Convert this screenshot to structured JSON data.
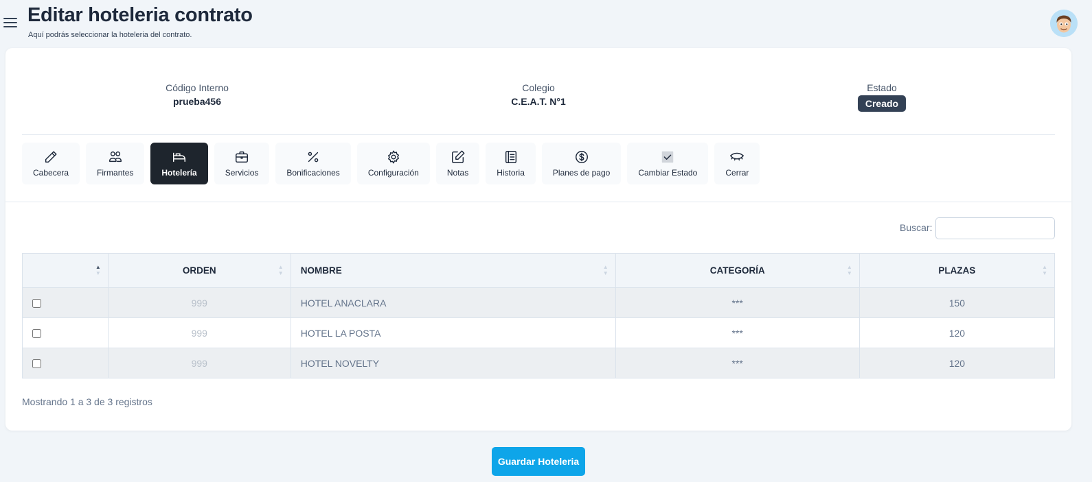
{
  "header": {
    "title": "Editar hoteleria contrato",
    "subtitle": "Aquí podrás seleccionar la hoteleria del contrato."
  },
  "summary": {
    "codigo_label": "Código Interno",
    "codigo_value": "prueba456",
    "colegio_label": "Colegio",
    "colegio_value": "C.E.A.T. N°1",
    "estado_label": "Estado",
    "estado_value": "Creado"
  },
  "tabs": [
    {
      "label": "Cabecera",
      "icon": "pencil-icon"
    },
    {
      "label": "Firmantes",
      "icon": "users-icon"
    },
    {
      "label": "Hotelería",
      "icon": "bed-icon",
      "active": true
    },
    {
      "label": "Servicios",
      "icon": "briefcase-icon"
    },
    {
      "label": "Bonificaciones",
      "icon": "percent-icon"
    },
    {
      "label": "Configuración",
      "icon": "gear-icon"
    },
    {
      "label": "Notas",
      "icon": "edit-note-icon"
    },
    {
      "label": "Historia",
      "icon": "journal-icon"
    },
    {
      "label": "Planes de pago",
      "icon": "dollar-circle-icon"
    },
    {
      "label": "Cambiar Estado",
      "icon": "check-square-icon"
    },
    {
      "label": "Cerrar",
      "icon": "eye-closed-icon"
    }
  ],
  "search": {
    "label": "Buscar:",
    "value": ""
  },
  "table": {
    "headers": [
      "",
      "ORDEN",
      "NOMBRE",
      "CATEGORÍA",
      "PLAZAS"
    ],
    "rows": [
      {
        "orden": "999",
        "nombre": "HOTEL ANACLARA",
        "categoria": "***",
        "plazas": "150"
      },
      {
        "orden": "999",
        "nombre": "HOTEL LA POSTA",
        "categoria": "***",
        "plazas": "120"
      },
      {
        "orden": "999",
        "nombre": "HOTEL NOVELTY",
        "categoria": "***",
        "plazas": "120"
      }
    ],
    "info": "Mostrando 1 a 3 de 3 registros"
  },
  "actions": {
    "save_label": "Guardar Hoteleria"
  },
  "colors": {
    "accent": "#0ea5e9",
    "active_tab": "#1e252d",
    "badge": "#334155"
  }
}
